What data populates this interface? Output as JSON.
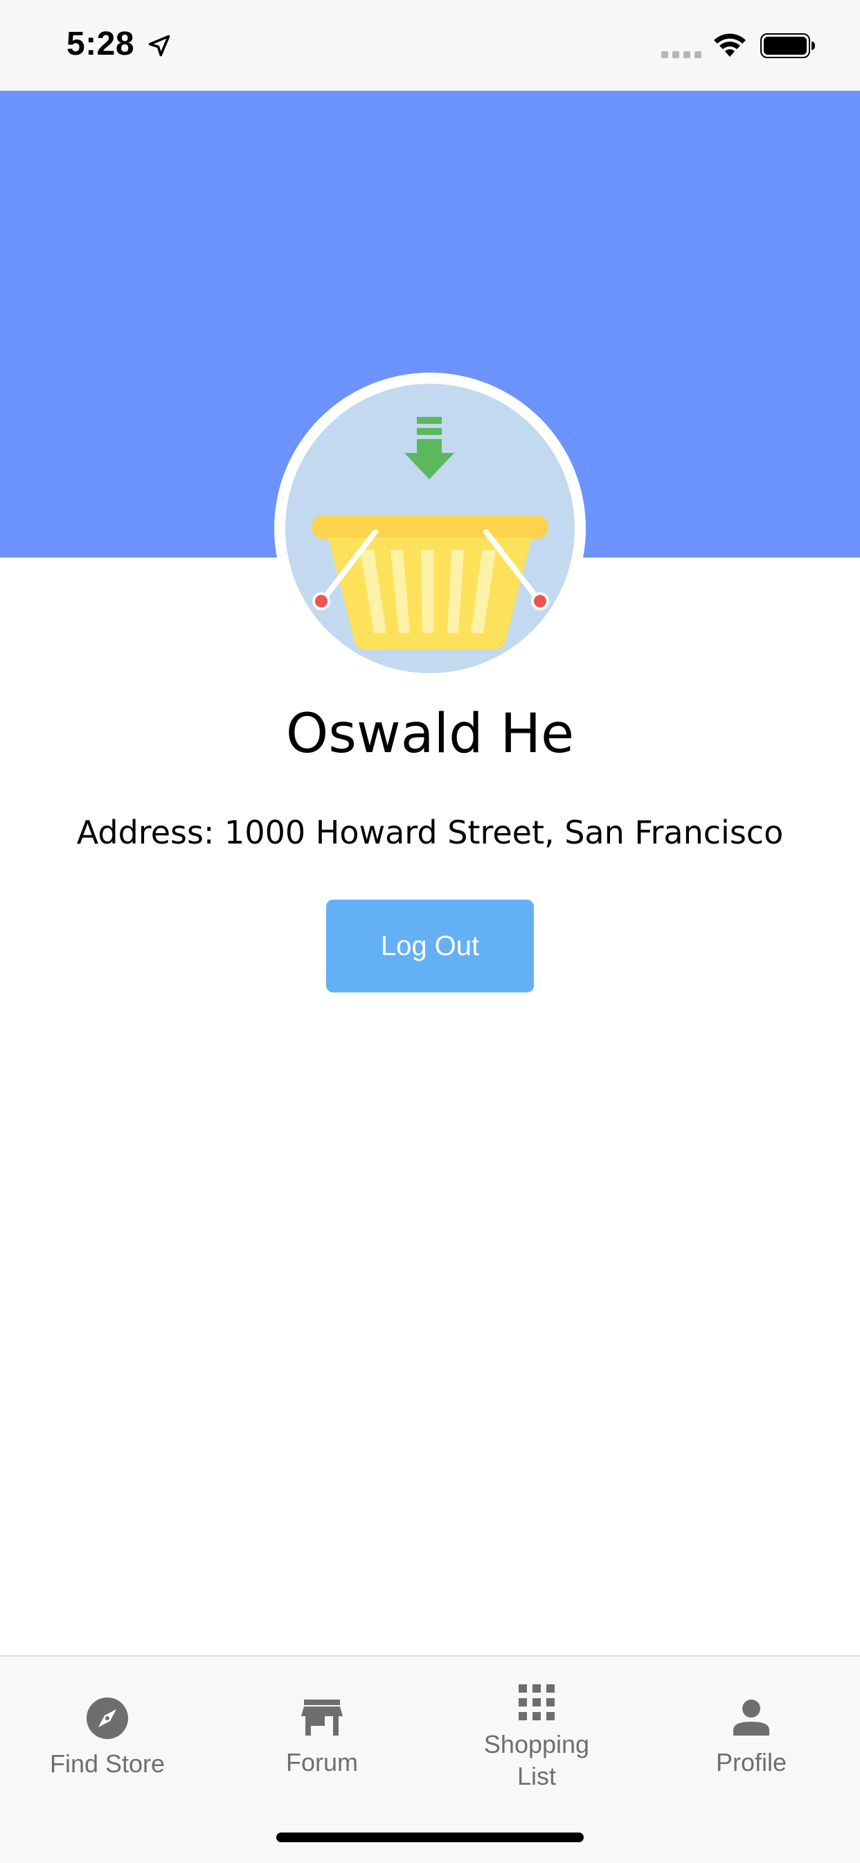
{
  "status_bar": {
    "time": "5:28"
  },
  "profile": {
    "name": "Oswald He",
    "address": "Address: 1000 Howard Street, San Francisco",
    "avatar_icon": "shopping-basket-icon"
  },
  "actions": {
    "logout_label": "Log Out"
  },
  "tabs": [
    {
      "label": "Find Store",
      "icon": "compass-icon"
    },
    {
      "label": "Forum",
      "icon": "store-icon"
    },
    {
      "label": "Shopping\nList",
      "icon": "grid-icon"
    },
    {
      "label": "Profile",
      "icon": "person-icon"
    }
  ],
  "colors": {
    "header_band": "#6c93ff",
    "button": "#64b0f5",
    "tab_inactive": "#6e6e6e"
  }
}
